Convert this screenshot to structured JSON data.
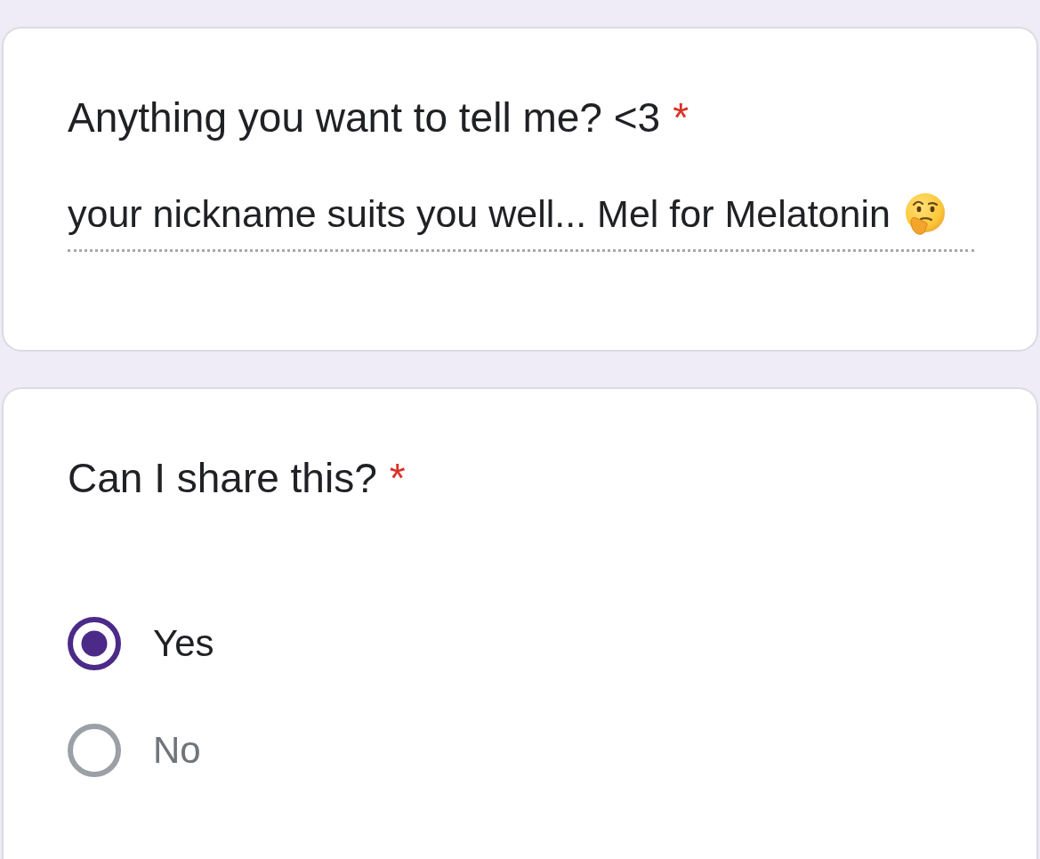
{
  "questions": [
    {
      "kind": "short_answer",
      "title": "Anything you want to tell me? <3",
      "required_mark": "*",
      "answer": "your nickname suits you well... Mel for Melatonin"
    },
    {
      "kind": "multiple_choice",
      "title": "Can I share this?",
      "required_mark": "*",
      "options": [
        {
          "label": "Yes",
          "selected": true
        },
        {
          "label": "No",
          "selected": false
        }
      ]
    }
  ]
}
